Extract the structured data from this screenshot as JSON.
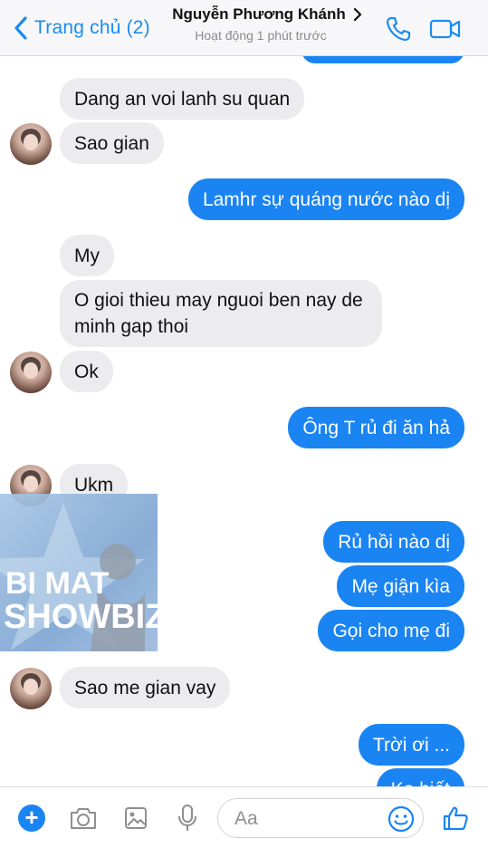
{
  "header": {
    "back_label": "Trang chủ (2)",
    "contact_name": "Nguyễn Phương Khánh",
    "status": "Hoạt động 1 phút trước",
    "icons": {
      "back": "chevron-left-icon",
      "phone": "phone-icon",
      "video": "video-camera-icon"
    }
  },
  "messages": [
    {
      "side": "in",
      "text": "Dang an voi lanh su quan"
    },
    {
      "side": "in",
      "text": "Sao gian"
    },
    {
      "side": "out",
      "text": "Lamhr sự quáng nước nào dị"
    },
    {
      "side": "in",
      "text": "My"
    },
    {
      "side": "in",
      "text": "O gioi thieu may nguoi ben nay de minh gap thoi"
    },
    {
      "side": "in",
      "text": "Ok"
    },
    {
      "side": "out",
      "text": "Ông T rủ đi ăn hả"
    },
    {
      "side": "in",
      "text": "Ukm"
    },
    {
      "side": "out",
      "text": "Rủ hồi nào dị"
    },
    {
      "side": "out",
      "text": "Mẹ giận kìa"
    },
    {
      "side": "out",
      "text": "Gọi cho mẹ đi"
    },
    {
      "side": "in",
      "text": "Sao me gian vay"
    },
    {
      "side": "out",
      "text": "Trời ơi ..."
    },
    {
      "side": "out",
      "text": "Ko biết"
    }
  ],
  "watermark": {
    "line1": "BI MAT",
    "line2": "SHOWBIZ"
  },
  "composer": {
    "placeholder": "Aa",
    "icons": [
      "plus-icon",
      "camera-icon",
      "image-icon",
      "microphone-icon",
      "emoji-icon",
      "thumbs-up-icon"
    ]
  },
  "colors": {
    "accent": "#1a84f2",
    "incoming_bubble": "#ececee",
    "header_bg": "#f7f7f9"
  }
}
